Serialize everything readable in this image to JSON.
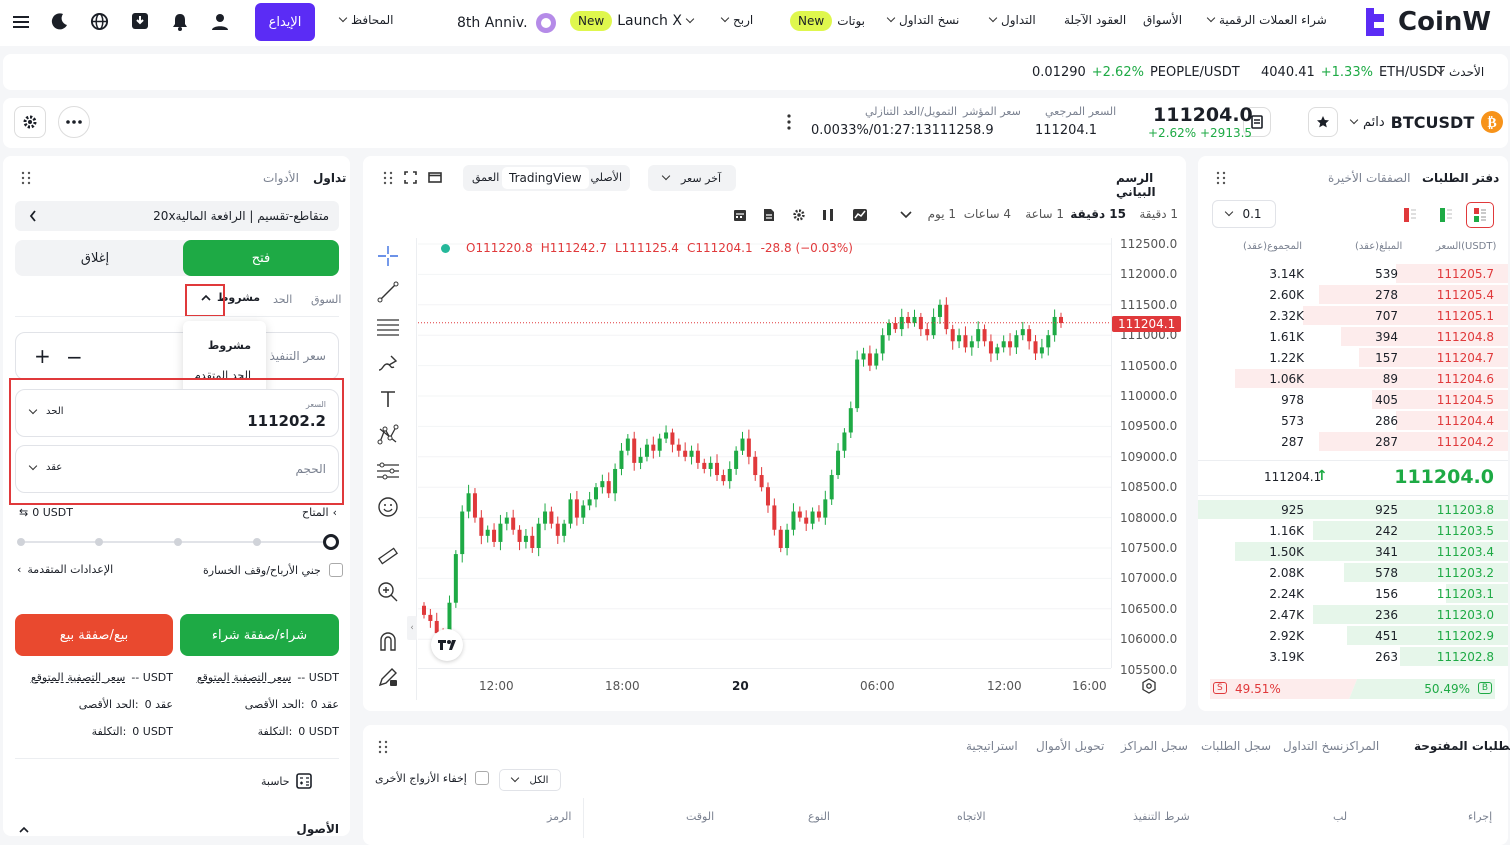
{
  "nav": {
    "logo": "CoinW",
    "buy_crypto": "شراء العملات الرقمية",
    "markets": "الأسواق",
    "futures": "العقود الآجلة",
    "trade": "التداول",
    "copy": "نسخ التداول",
    "bots": "بوتات",
    "earn": "اربح",
    "launchx": "Launch X",
    "anniv": "8th Anniv.",
    "new_badge": "New",
    "wallets": "المحافظ",
    "deposit": "الإيداع"
  },
  "ticker": {
    "latest": "الأحدث",
    "eth_pair": "ETH/USDT",
    "eth_change": "+1.33%",
    "eth_price": "4040.41",
    "people_pair": "PEOPLE/USDT",
    "people_change": "+2.62%",
    "people_price": "0.01290"
  },
  "pair": {
    "name": "BTCUSDT",
    "type": "دائم",
    "price": "111204.0",
    "change": "+2.62% +2913.5",
    "ref_label": "السعر المرجعي",
    "ref_value": "111204.1",
    "index_label": "سعر المؤشر",
    "index_value": "111258.9",
    "funding_label": "التمويل/العد التنازلي",
    "funding_value": "0.0033%/01:27:13"
  },
  "form": {
    "tab_trade": "تداول",
    "tab_tools": "الأدوات",
    "margin_mode": "متقاطع-تقسيم | الرافعة المالية20x",
    "open": "فتح",
    "close": "إغلاق",
    "type_market": "السوق",
    "type_limit": "الحد",
    "type_conditional": "مشروط",
    "dropdown_conditional": "مشروط",
    "dropdown_advanced": "الحد المتقدم",
    "exec_price": "سعر التنفيذ",
    "price_label": "السعر",
    "price_value": "111202.2",
    "price_unit": "الحد",
    "size_label": "الحجم",
    "size_unit": "عقد",
    "available_label": "المتاح",
    "available_value": "0 USDT",
    "tpsl": "جني الأرباح/وقف الخسارة",
    "advanced": "الإعدادات المتقدمة",
    "buy": "شراء/صفقة شراء",
    "sell": "بيع/صفقة بيع",
    "liq_label": "سعر التصفية المتوقع",
    "liq_value": "-- USDT",
    "max_label": "الحد الأقصى:",
    "max_value": "0 عقد",
    "cost_label": "التكلفة:",
    "cost_value": "0 USDT",
    "calculator": "حاسبة",
    "assets": "الأصول"
  },
  "chart": {
    "title": "الرسم البياني",
    "view_original": "الأصلي",
    "view_tv": "TradingView",
    "view_depth": "العمق",
    "price_mode": "آخر سعر",
    "intervals": [
      "1 دقيقة",
      "15 دقيقة",
      "1 ساعة",
      "4 ساعات",
      "1 يوم"
    ],
    "active_interval": 1,
    "ohlc": {
      "o": "O111220.8",
      "h": "H111242.7",
      "l": "L111125.4",
      "c": "C111204.1",
      "chg": "-28.8 (−0.03%)"
    },
    "last_price_tag": "111204.1"
  },
  "chart_data": {
    "type": "candlestick",
    "title": "",
    "y_ticks": [
      "112500.0",
      "112000.0",
      "111500.0",
      "111000.0",
      "110500.0",
      "110000.0",
      "109500.0",
      "109000.0",
      "108500.0",
      "108000.0",
      "107500.0",
      "107000.0",
      "106500.0",
      "106000.0",
      "105500.0"
    ],
    "x_ticks": [
      "12:00",
      "18:00",
      "20",
      "06:00",
      "12:00",
      "16:00"
    ],
    "ylim": [
      105500,
      112700
    ],
    "last_price": 111204.1,
    "closes": [
      106400,
      106300,
      106100,
      105900,
      106600,
      107400,
      108100,
      108400,
      108000,
      107700,
      107800,
      107600,
      107900,
      108000,
      107800,
      107600,
      107700,
      107500,
      107900,
      108100,
      107900,
      107700,
      107900,
      108300,
      108000,
      108200,
      108300,
      108500,
      108600,
      108400,
      108800,
      109100,
      109300,
      108900,
      109000,
      109200,
      109100,
      109300,
      109400,
      109200,
      109100,
      109000,
      109100,
      108900,
      108800,
      108900,
      108700,
      108600,
      108800,
      109100,
      109300,
      109000,
      108700,
      108500,
      108200,
      107800,
      107500,
      107800,
      108100,
      108000,
      107900,
      108100,
      108000,
      108300,
      108700,
      109100,
      109400,
      109800,
      110600,
      110700,
      110500,
      110700,
      111000,
      111200,
      111100,
      111300,
      111200,
      111300,
      111100,
      111000,
      111300,
      111500,
      111100,
      110900,
      111000,
      110800,
      110900,
      111100,
      110900,
      110700,
      110800,
      110900,
      110800,
      111000,
      111100,
      110900,
      110700,
      110800,
      111000,
      111300,
      111200
    ]
  },
  "book": {
    "tab_orderbook": "دفتر الطلبات",
    "tab_trades": "الصفقات الأخيرة",
    "precision": "0.1",
    "col_price": "السعر(USDT)",
    "col_amount": "المبلغ(عقد)",
    "col_total": "المجموع(عقد)",
    "asks": [
      {
        "price": "111205.7",
        "amount": "539",
        "total": "3.14K",
        "depth": 0.36
      },
      {
        "price": "111205.4",
        "amount": "278",
        "total": "2.60K",
        "depth": 0.61
      },
      {
        "price": "111205.1",
        "amount": "707",
        "total": "2.32K",
        "depth": 0.66
      },
      {
        "price": "111204.8",
        "amount": "394",
        "total": "1.61K",
        "depth": 0.54
      },
      {
        "price": "111204.7",
        "amount": "157",
        "total": "1.22K",
        "depth": 0.48
      },
      {
        "price": "111204.6",
        "amount": "89",
        "total": "1.06K",
        "depth": 0.88
      },
      {
        "price": "111204.5",
        "amount": "405",
        "total": "978",
        "depth": 0.44
      },
      {
        "price": "111204.4",
        "amount": "286",
        "total": "573",
        "depth": 0.36
      },
      {
        "price": "111204.2",
        "amount": "287",
        "total": "287",
        "depth": 0.61
      }
    ],
    "mid_price": "111204.0",
    "mid_ref": "111204.1",
    "bids": [
      {
        "price": "111203.8",
        "amount": "925",
        "total": "925",
        "depth": 1.0
      },
      {
        "price": "111203.5",
        "amount": "242",
        "total": "1.16K",
        "depth": 0.63
      },
      {
        "price": "111203.4",
        "amount": "341",
        "total": "1.50K",
        "depth": 0.88
      },
      {
        "price": "111203.2",
        "amount": "578",
        "total": "2.08K",
        "depth": 0.53
      },
      {
        "price": "111203.1",
        "amount": "156",
        "total": "2.24K",
        "depth": 0.2
      },
      {
        "price": "111203.0",
        "amount": "236",
        "total": "2.47K",
        "depth": 0.63
      },
      {
        "price": "111202.9",
        "amount": "451",
        "total": "2.92K",
        "depth": 0.52
      },
      {
        "price": "111202.8",
        "amount": "263",
        "total": "3.19K",
        "depth": 0.35
      }
    ],
    "sell_ratio": "49.51%",
    "buy_ratio": "50.49%",
    "sell_tag": "S",
    "buy_tag": "B"
  },
  "bottom": {
    "tabs": [
      "الطلبات المفتوحة",
      "المراكز",
      "نسخ التداول",
      "سجل الطلبات",
      "سجل المراكز",
      "تحويل الأموال",
      "استراتيجية"
    ],
    "filter_all": "الكل",
    "hide_pairs": "إخفاء الأزواج الأخرى",
    "columns": [
      "إجراء",
      "لب",
      "شرط التنفيذ",
      "الاتجاه",
      "النوع",
      "الوقت",
      "الرمز"
    ]
  },
  "colors": {
    "up": "#1eaa45",
    "down": "#e0393b",
    "brand": "#5b2cf5",
    "accent": "#dff74d"
  }
}
